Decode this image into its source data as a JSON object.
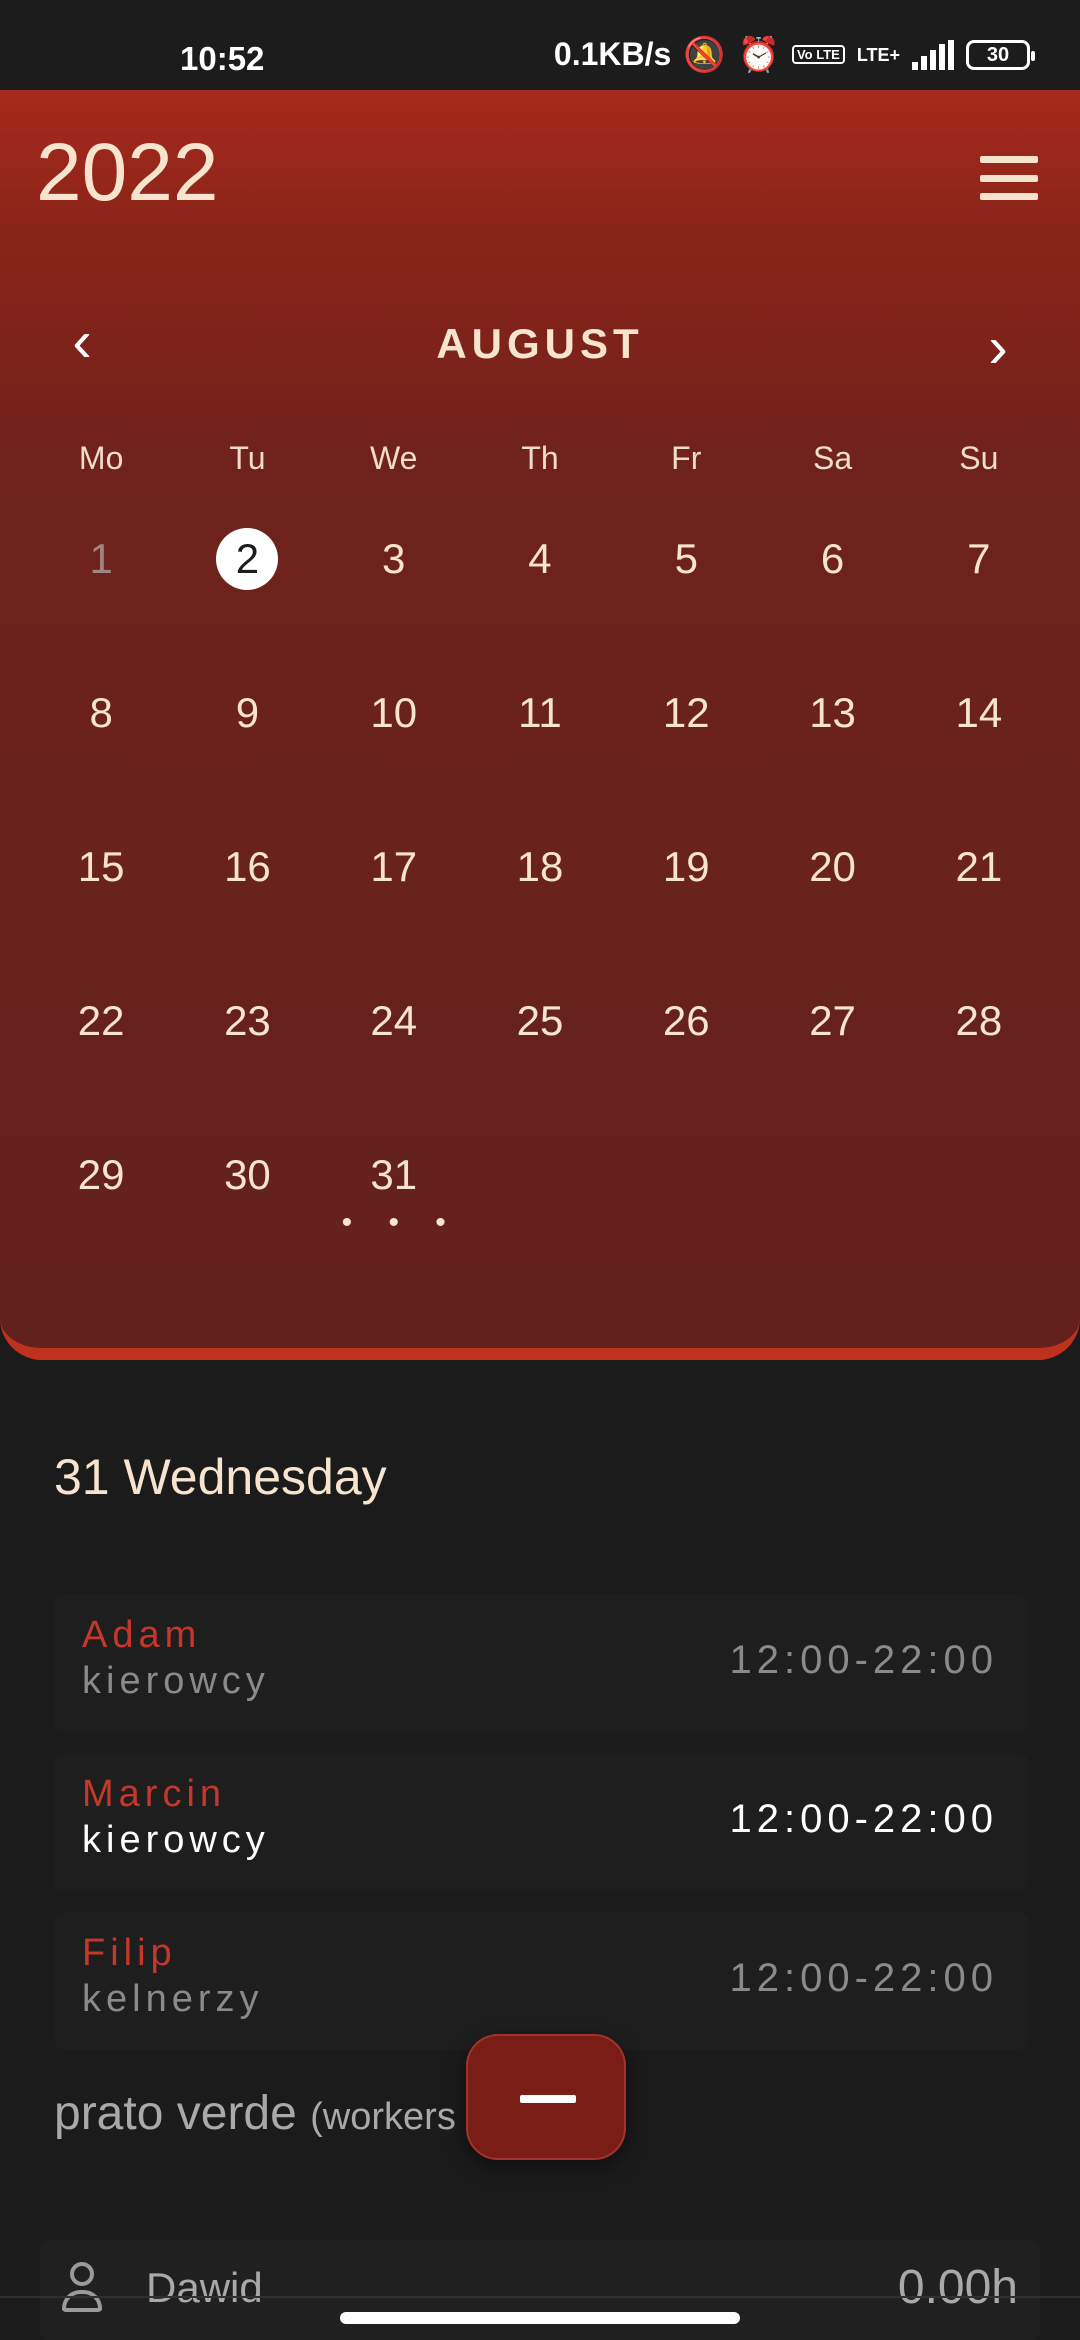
{
  "status_bar": {
    "time": "10:52",
    "network_speed": "0.1KB/s",
    "volte_badge": "Vo LTE",
    "lte_label": "LTE+",
    "battery": "30",
    "icons": [
      "mute-bell-icon",
      "alarm-icon",
      "volte-icon",
      "signal-icon",
      "battery-icon"
    ]
  },
  "header": {
    "year": "2022",
    "menu_icon": "hamburger-menu-icon"
  },
  "calendar": {
    "month": "AUGUST",
    "prev_icon": "chevron-left-icon",
    "next_icon": "chevron-right-icon",
    "weekdays": [
      "Mo",
      "Tu",
      "We",
      "Th",
      "Fr",
      "Sa",
      "Su"
    ],
    "days": [
      "1",
      "2",
      "3",
      "4",
      "5",
      "6",
      "7",
      "8",
      "9",
      "10",
      "11",
      "12",
      "13",
      "14",
      "15",
      "16",
      "17",
      "18",
      "19",
      "20",
      "21",
      "22",
      "23",
      "24",
      "25",
      "26",
      "27",
      "28",
      "29",
      "30",
      "31"
    ],
    "today": "2",
    "muted_day": "1",
    "selected_day_marker": "• • •"
  },
  "selected_date_label": "31 Wednesday",
  "shifts": [
    {
      "name": "Adam",
      "role": "kierowcy",
      "time": "12:00-22:00",
      "active": false
    },
    {
      "name": "Marcin",
      "role": "kierowcy",
      "time": "12:00-22:00",
      "active": true
    },
    {
      "name": "Filip",
      "role": "kelnerzy",
      "time": "12:00-22:00",
      "active": false
    }
  ],
  "section": {
    "title": "prato verde",
    "subtitle": "(workers"
  },
  "fab": {
    "icon": "minus-icon"
  },
  "worker": {
    "name": "Dawid",
    "hours": "0.00h",
    "icon": "person-icon"
  },
  "colors": {
    "accent_red": "#c4372a",
    "header_gradient_top": "#a8291d",
    "background": "#1b1b1b",
    "cream_text": "#f7e4cf"
  }
}
